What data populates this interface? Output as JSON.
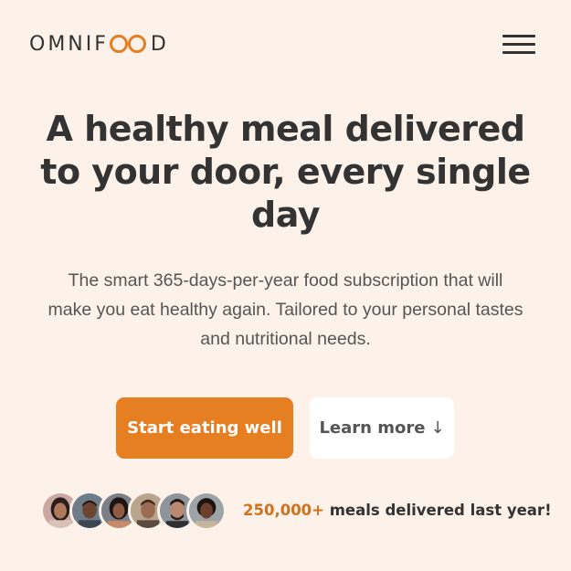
{
  "header": {
    "logo_text_left": "OMNIF",
    "logo_text_right": "D",
    "logo_accent_color": "#e67e22",
    "menu_icon": "hamburger-menu-icon"
  },
  "hero": {
    "title_line1": "A healthy meal delivered",
    "title_line2": "to your door, every single",
    "title_line3": "day",
    "description_line1": "The smart 365-days-per-year food subscription that will",
    "description_line2": "make you eat healthy again. Tailored to your personal tastes",
    "description_line3": "and nutritional needs."
  },
  "buttons": {
    "primary_label": "Start eating well",
    "secondary_label": "Learn more",
    "secondary_arrow": "↓"
  },
  "delivered": {
    "count": "250,000+",
    "text": " meals delivered last year!"
  },
  "colors": {
    "background": "#fdf2e9",
    "primary": "#e67e22",
    "text_dark": "#333333",
    "text_muted": "#555555"
  }
}
